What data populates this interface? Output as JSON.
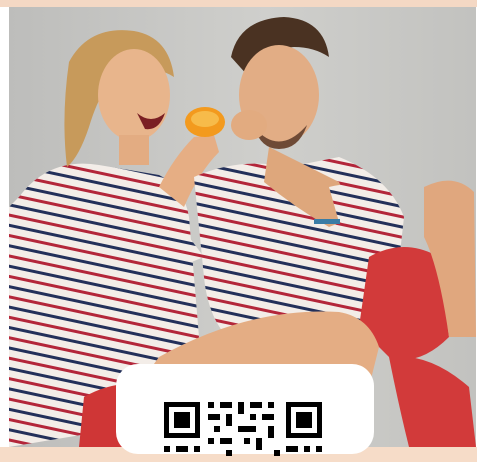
{
  "image": {
    "subject": "",
    "colors": {
      "background_band": "#f4d8c4",
      "wall": "#c9c9c6",
      "stripe_red": "#b3263a",
      "stripe_navy": "#23305a",
      "shirt_base": "#f3ede8",
      "shorts_red": "#d23a3a",
      "orange": "#f39a1e",
      "skin": "#e8b58c",
      "hair_blonde": "#c79a5b",
      "hair_brown": "#4a3222"
    }
  },
  "qr_card": {
    "icon": "qr-code-icon"
  }
}
